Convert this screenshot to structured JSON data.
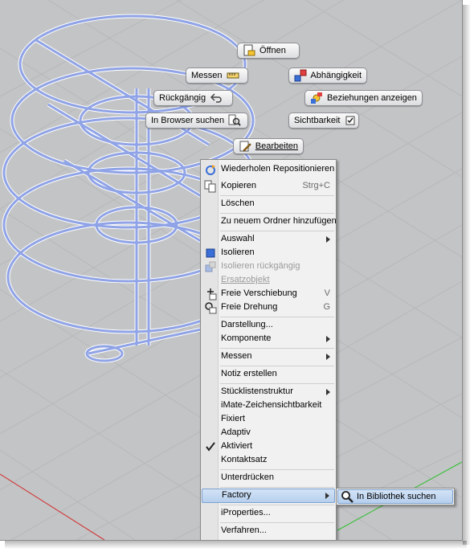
{
  "marking_menu": {
    "items": [
      {
        "label": "Öffnen",
        "icon": "open-file-icon"
      },
      {
        "label": "Messen",
        "icon": "ruler-icon"
      },
      {
        "label": "Abhängigkeit",
        "icon": "constraint-icon"
      },
      {
        "label": "Rückgängig",
        "icon": "undo-arrow-icon"
      },
      {
        "label": "Beziehungen anzeigen",
        "icon": "relationships-icon"
      },
      {
        "label": "In Browser suchen",
        "icon": "browser-find-icon"
      },
      {
        "label": "Sichtbarkeit",
        "icon": "checkbox-checked-icon"
      },
      {
        "label": "Bearbeiten",
        "icon": "edit-pencil-icon"
      }
    ]
  },
  "context_menu": {
    "items": [
      {
        "label": "Wiederholen Repositionieren",
        "icon": "repeat-icon"
      },
      {
        "label": "Kopieren",
        "shortcut": "Strg+C",
        "icon": "copy-icon"
      },
      {
        "label": "Löschen"
      },
      {
        "label": "Zu neuem Ordner hinzufügen"
      },
      {
        "label": "Auswahl",
        "submenu": true
      },
      {
        "label": "Isolieren",
        "icon": "isolate-icon"
      },
      {
        "label": "Isolieren rückgängig",
        "disabled": true,
        "icon": "undo-isolate-icon"
      },
      {
        "label": "Ersatzobjekt",
        "disabled": true
      },
      {
        "label": "Freie Verschiebung",
        "shortcut": "V",
        "icon": "free-move-icon"
      },
      {
        "label": "Freie Drehung",
        "shortcut": "G",
        "icon": "free-rotate-icon"
      },
      {
        "label": "Darstellung..."
      },
      {
        "label": "Komponente",
        "submenu": true
      },
      {
        "label": "Messen",
        "submenu": true
      },
      {
        "label": "Notiz erstellen"
      },
      {
        "label": "Stücklistenstruktur",
        "submenu": true
      },
      {
        "label": "iMate-Zeichensichtbarkeit"
      },
      {
        "label": "Fixiert"
      },
      {
        "label": "Adaptiv"
      },
      {
        "label": "Aktiviert",
        "checked": true
      },
      {
        "label": "Kontaktsatz"
      },
      {
        "label": "Unterdrücken"
      },
      {
        "label": "Factory",
        "submenu": true,
        "highlighted": true
      },
      {
        "label": "iProperties..."
      },
      {
        "label": "Verfahren..."
      }
    ]
  },
  "submenu": {
    "items": [
      {
        "label": "In Bibliothek suchen",
        "icon": "magnifier-icon"
      }
    ]
  },
  "colors": {
    "viewport_bg": "#c3c4c6",
    "model_wire": "#8fa3e6",
    "grid_line": "#b5b6b8",
    "axis_red": "#d22b2b",
    "axis_green": "#2fbf2f",
    "highlight": "#b6cfed"
  }
}
